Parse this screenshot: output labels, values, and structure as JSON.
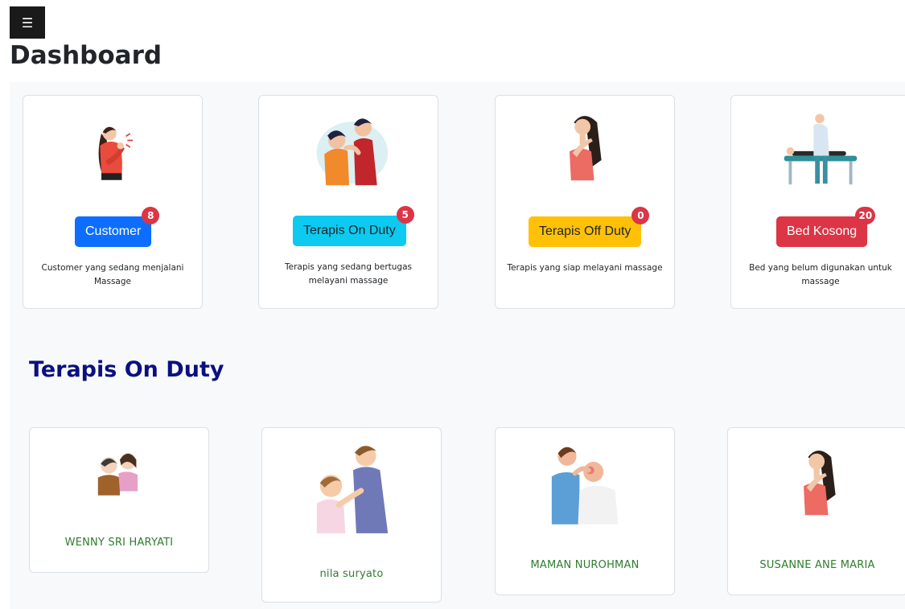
{
  "header": {
    "menu_icon": "☰",
    "title": "Dashboard"
  },
  "stats": [
    {
      "label": "Customer",
      "count": "8",
      "description": "Customer yang sedang menjalani Massage",
      "color": "#0d6efd",
      "text_color": "#ffffff",
      "icon": "customer-pain-illustration"
    },
    {
      "label": "Terapis On Duty",
      "count": "5",
      "description": "Terapis yang sedang bertugas melayani massage",
      "color": "#0dcaf0",
      "text_color": "#212529",
      "icon": "therapist-massage-illustration"
    },
    {
      "label": "Terapis Off Duty",
      "count": "0",
      "description": "Terapis yang siap melayani massage",
      "color": "#ffc107",
      "text_color": "#212529",
      "icon": "woman-neck-pain-illustration"
    },
    {
      "label": "Bed Kosong",
      "count": "20",
      "description": "Bed yang belum digunakan untuk massage",
      "color": "#dc3545",
      "text_color": "#ffffff",
      "icon": "massage-bed-illustration"
    }
  ],
  "section": {
    "title": "Terapis On Duty"
  },
  "therapists": [
    {
      "name": "WENNY SRI HARYATI"
    },
    {
      "name": "nila suryato"
    },
    {
      "name": "MAMAN NUROHMAN"
    },
    {
      "name": "SUSANNE ANE MARIA"
    }
  ],
  "colors": {
    "name_text": "#2e7d2e",
    "section_title": "#0a1080",
    "badge": "#dc3545",
    "panel": "#f8f9fa"
  }
}
